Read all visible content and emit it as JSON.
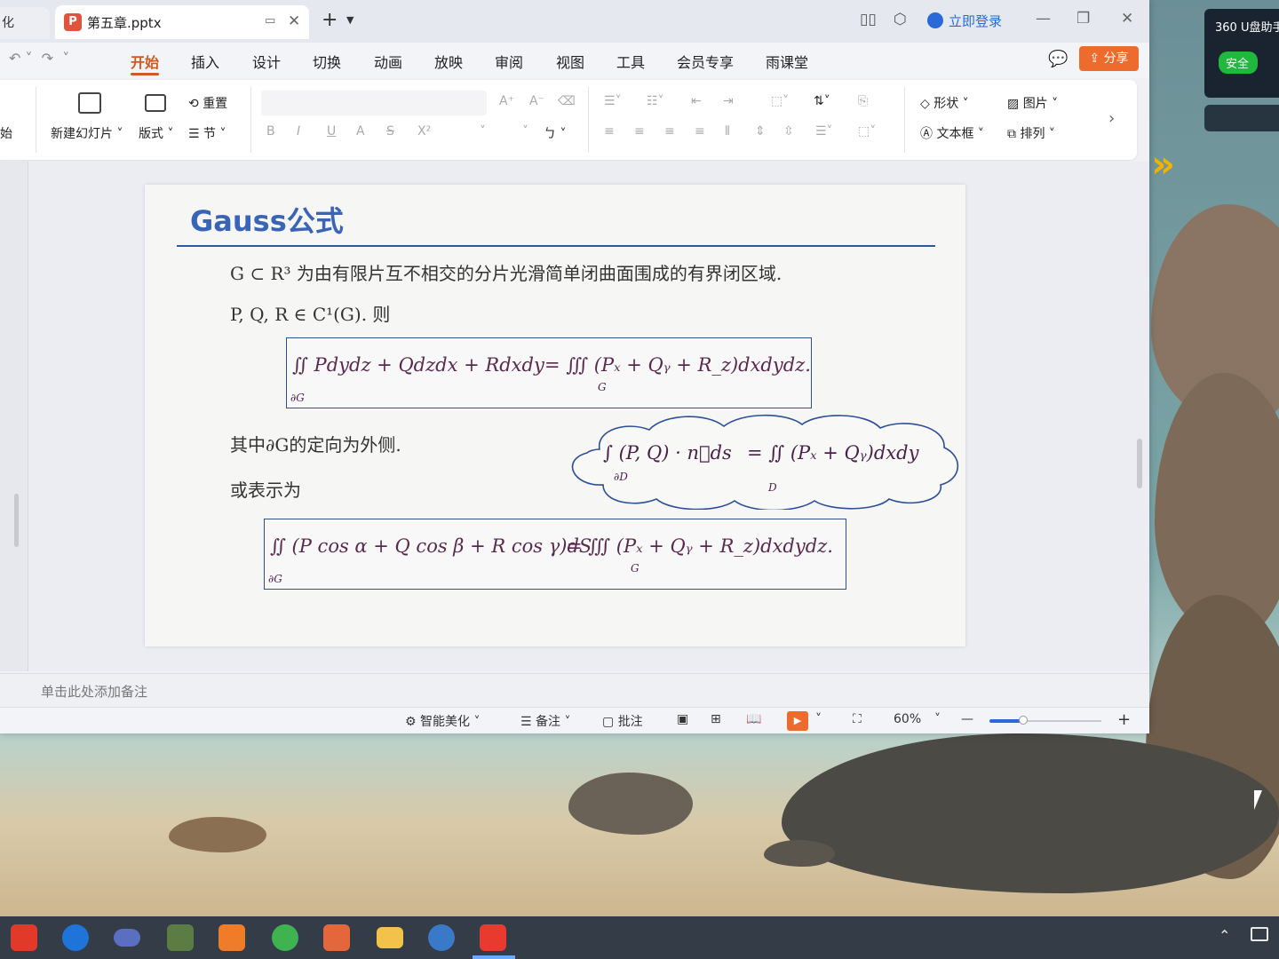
{
  "titlebar": {
    "left_tab_fragment": "化",
    "tab_title": "第五章.pptx",
    "ppt_icon_letter": "P",
    "login": "立即登录",
    "icons": [
      "reading-mode-icon",
      "cube-icon",
      "user-avatar-icon",
      "minimize-icon",
      "restore-icon",
      "close-icon"
    ]
  },
  "menubar": {
    "items": [
      "开始",
      "插入",
      "设计",
      "切换",
      "动画",
      "放映",
      "审阅",
      "视图",
      "工具",
      "会员专享",
      "雨课堂"
    ],
    "active": "开始",
    "share": "分享"
  },
  "ribbon": {
    "begin_fragment": "始",
    "new_slide": "新建幻灯片",
    "layout": "版式",
    "reset": "重置",
    "section": "节",
    "bold": "B",
    "italic": "I",
    "underline": "U",
    "strike": "A",
    "shadow": "S",
    "superscript": "X²",
    "shape": "形状",
    "image": "图片",
    "textbox": "文本框",
    "arrange": "排列"
  },
  "slide": {
    "title": "Gauss公式",
    "line1": "G ⊂ R³ 为由有限片互不相交的分片光滑简单闭曲面围成的有界闭区域.",
    "line2": "P, Q, R ∈ C¹(G). 则",
    "formula1": {
      "lhs": "∬ Pdydz + Qdzdx + Rdxdy",
      "lhs_sub": "∂G",
      "rhs": "= ∭ (Pₓ + Qᵧ + R_z)dxdydz.",
      "rhs_sub": "G"
    },
    "line3": "其中∂G的定向为外侧.",
    "line4": "或表示为",
    "cloud": {
      "lhs": "∫ (P, Q) · n⃗ds",
      "lhs_sub": "∂D",
      "rhs": "= ∬ (Pₓ + Qᵧ)dxdy",
      "rhs_sub": "D"
    },
    "formula2": {
      "lhs": "∬ (P cos α + Q cos β + R cos γ)dS",
      "lhs_sub": "∂G",
      "rhs": "= ∭ (Pₓ + Qᵧ + R_z)dxdydz.",
      "rhs_sub": "G"
    }
  },
  "notes_placeholder": "单击此处添加备注",
  "statusbar": {
    "beautify": "智能美化",
    "notes": "备注",
    "comment": "批注",
    "zoom": "60%",
    "zoom_level": 0.3
  },
  "widget360": {
    "title": "360 U盘助手",
    "safe": "安全"
  },
  "taskbar": {
    "apps": [
      "feather-app-icon",
      "media-player-icon",
      "swirl-app-icon",
      "game-app-icon",
      "hexagon-app-icon",
      "green-browser-icon",
      "powerpoint-icon",
      "file-explorer-icon",
      "settings-app-icon",
      "wps-icon"
    ]
  }
}
